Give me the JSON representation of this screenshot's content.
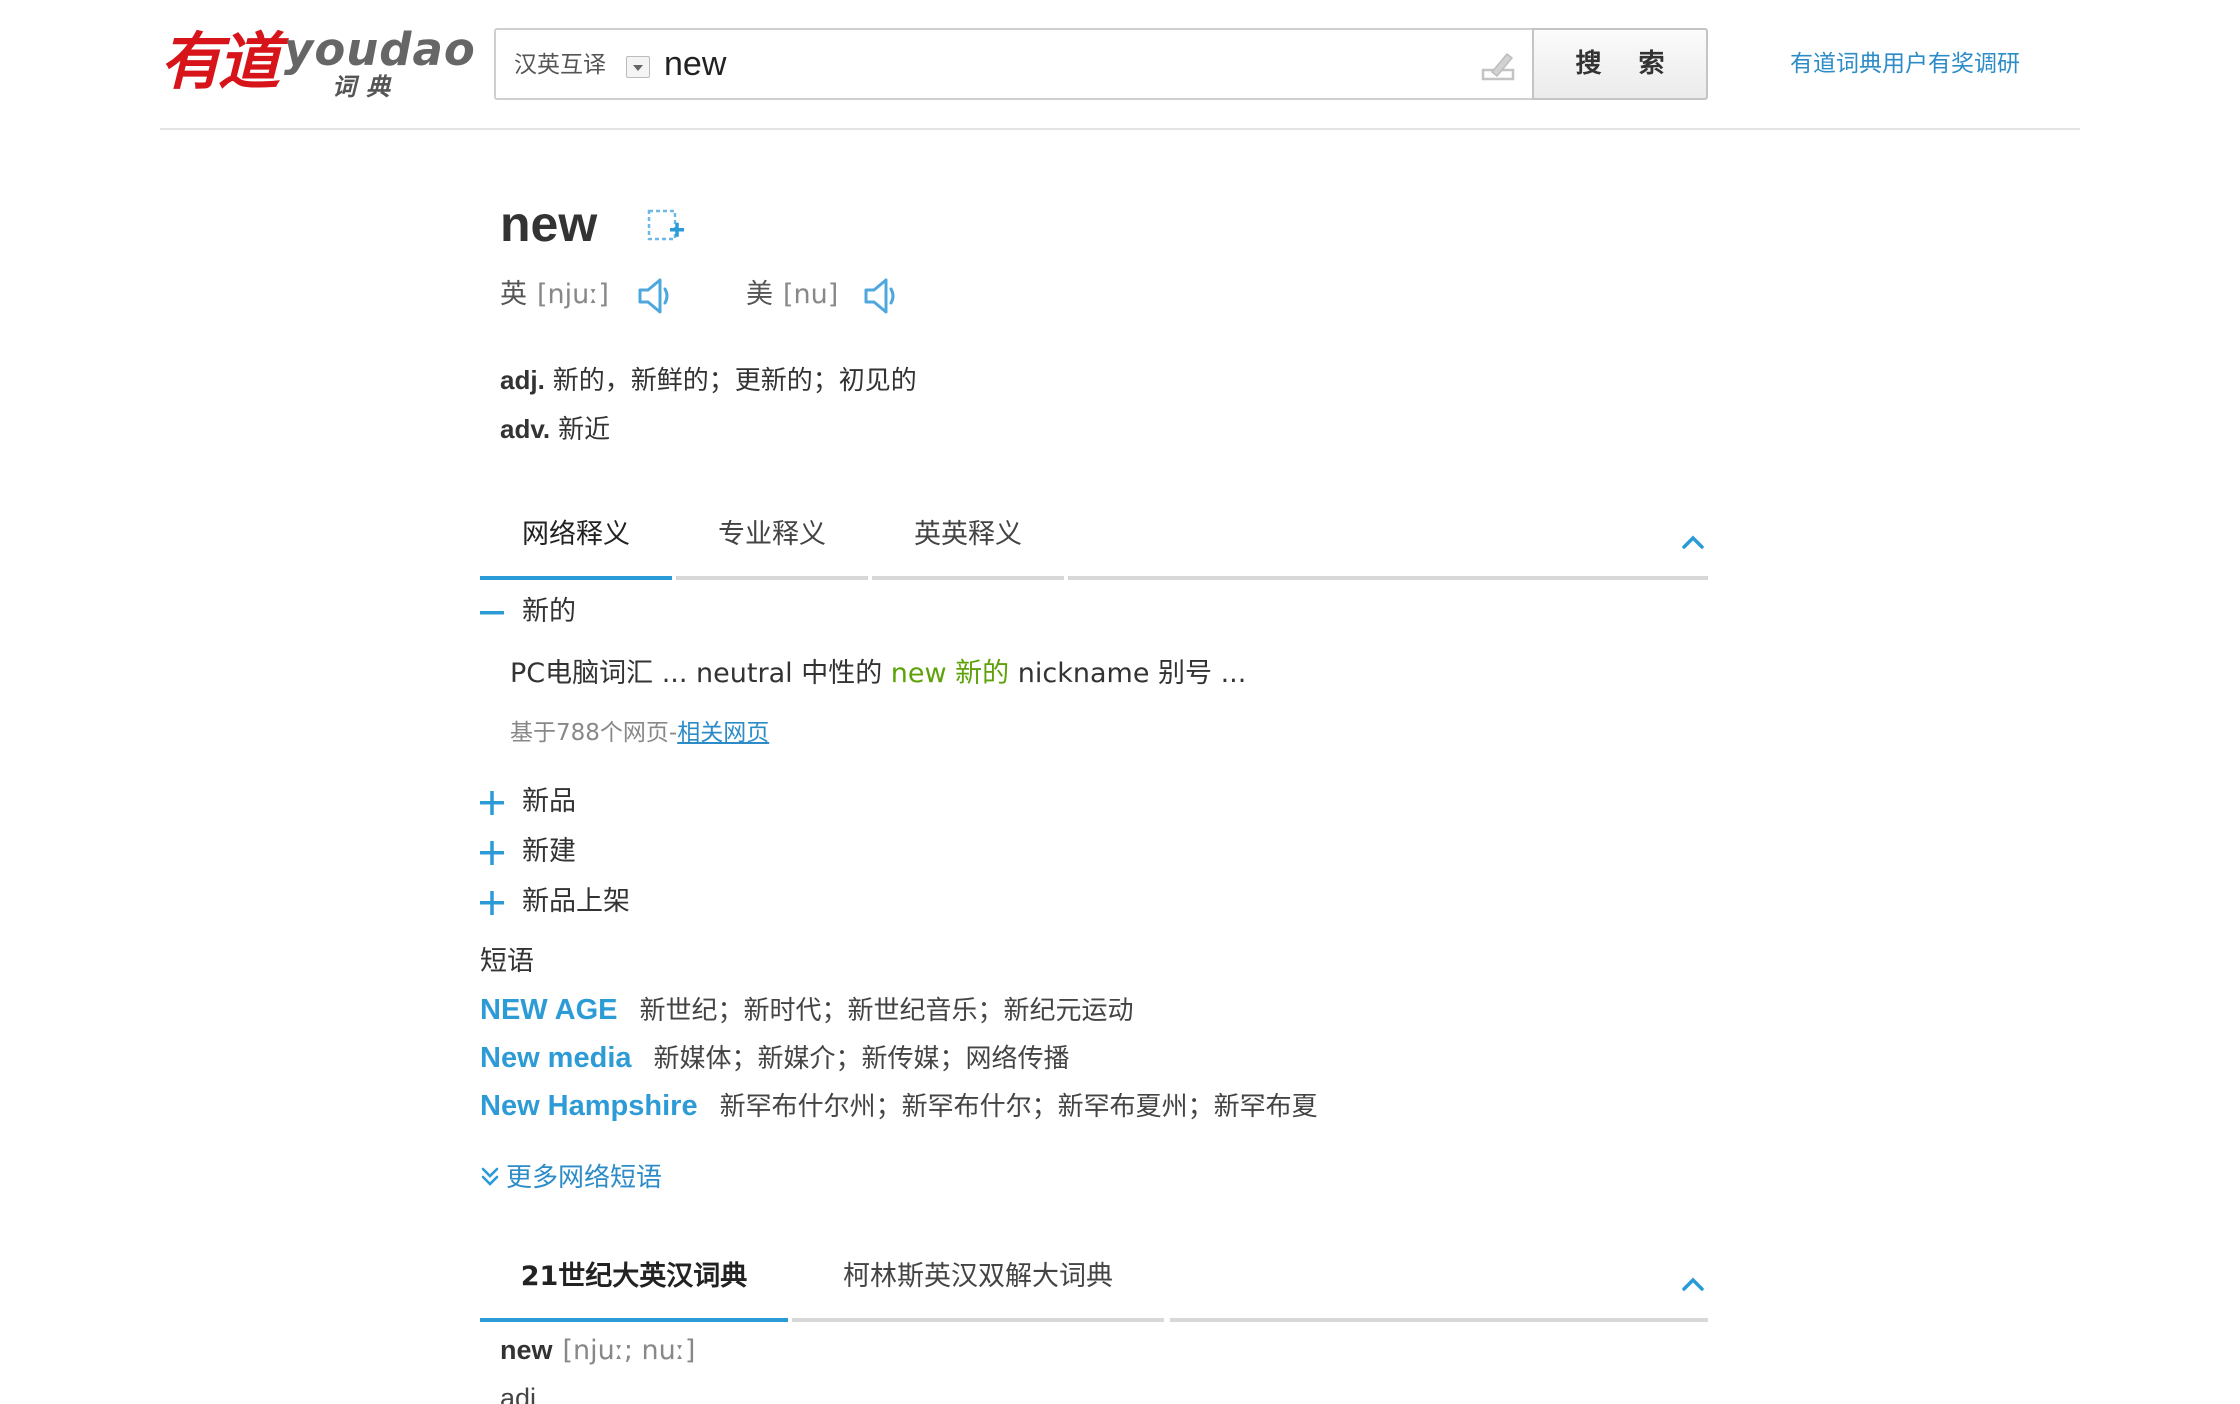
{
  "header": {
    "logo_cn": "有道",
    "logo_en": "youdao",
    "logo_sub": "词典",
    "lang_select": "汉英互译",
    "search_value": "new",
    "search_button": "搜 索",
    "survey_link": "有道词典用户有奖调研"
  },
  "word": {
    "keyword": "new",
    "uk_label": "英",
    "uk_phonetic": "[njuː]",
    "us_label": "美",
    "us_phonetic": "[nu]",
    "definitions": [
      {
        "pos": "adj.",
        "text": "新的，新鲜的；更新的；初见的"
      },
      {
        "pos": "adv.",
        "text": "新近"
      }
    ]
  },
  "tabs": [
    "网络释义",
    "专业释义",
    "英英释义"
  ],
  "web_definitions": {
    "expanded_term": "新的",
    "example_before": "PC电脑词汇 ... neutral 中性的 ",
    "example_highlight": "new 新的",
    "example_after": " nickname 别号 ...",
    "source_text": "基于788个网页-",
    "source_link": "相关网页",
    "collapsed_terms": [
      "新品",
      "新建",
      "新品上架"
    ]
  },
  "phrases": {
    "title": "短语",
    "items": [
      {
        "en": "NEW AGE",
        "zh": "新世纪；新时代；新世纪音乐；新纪元运动"
      },
      {
        "en": "New media",
        "zh": "新媒体；新媒介；新传媒；网络传播"
      },
      {
        "en": "New Hampshire",
        "zh": "新罕布什尔州；新罕布什尔；新罕布夏州；新罕布夏"
      }
    ],
    "more_link": "更多网络短语"
  },
  "dict_tabs": [
    "21世纪大英汉词典",
    "柯林斯英汉双解大词典"
  ],
  "dict_entry": {
    "word": "new",
    "phonetic": "[njuː; nuː]",
    "pos": "adj."
  },
  "colors": {
    "accent": "#2b9bd7",
    "link": "#2d8cc8",
    "highlight": "#5ea20a",
    "logo_red": "#d7141a"
  }
}
